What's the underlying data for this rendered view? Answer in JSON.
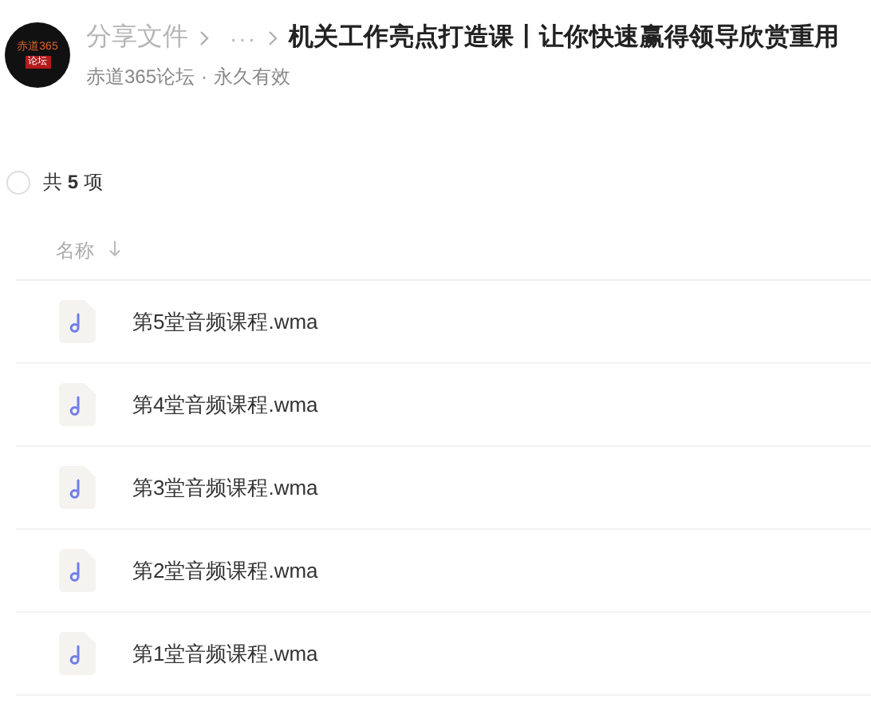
{
  "header": {
    "logo_text": [
      "赤道365",
      "论坛"
    ],
    "breadcrumb": [
      {
        "label": "分享文件"
      },
      {
        "label": "···"
      }
    ],
    "title": "机关工作亮点打造课丨让你快速赢得领导欣赏重用",
    "owner": "赤道365论坛",
    "separator": "·",
    "validity": "永久有效"
  },
  "select_all": {
    "checked": false,
    "label": "共 **5** 项"
  },
  "table": {
    "column": "名称",
    "rows": [
      {
        "name": "第5堂音频课程.wma"
      },
      {
        "name": "第4堂音频课程.wma"
      },
      {
        "name": "第3堂音频课程.wma"
      },
      {
        "name": "第2堂音频课程.wma"
      },
      {
        "name": "第1堂音频课程.wma"
      }
    ]
  }
}
